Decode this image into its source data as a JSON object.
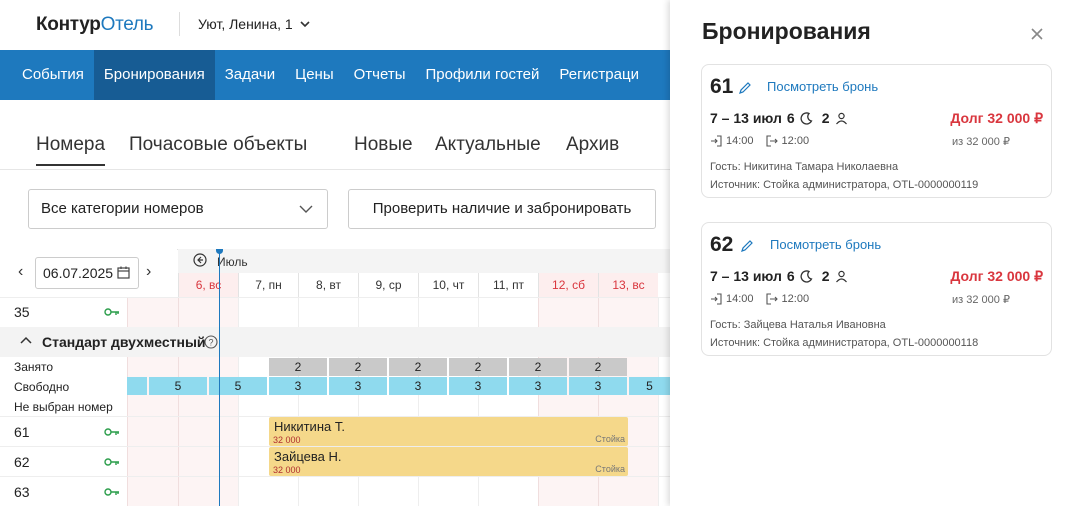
{
  "header": {
    "logo_part1": "Контур",
    "logo_part2": "Отель",
    "hotel_name": "Уют, Ленина, 1"
  },
  "nav": {
    "items": [
      "События",
      "Бронирования",
      "Задачи",
      "Цены",
      "Отчеты",
      "Профили гостей",
      "Регистраци"
    ],
    "active": "Бронирования"
  },
  "tabs": {
    "rooms": "Номера",
    "hourly": "Почасовые объекты",
    "new": "Новые",
    "current": "Актуальные",
    "archive": "Архив"
  },
  "filters": {
    "category_select": "Все категории номеров",
    "check_button": "Проверить наличие и забронировать"
  },
  "calendar": {
    "date": "06.07.2025",
    "month": "Июль",
    "days": [
      {
        "label": "6, вс",
        "weekend": true
      },
      {
        "label": "7, пн",
        "weekend": false
      },
      {
        "label": "8, вт",
        "weekend": false
      },
      {
        "label": "9, ср",
        "weekend": false
      },
      {
        "label": "10, чт",
        "weekend": false
      },
      {
        "label": "11, пт",
        "weekend": false
      },
      {
        "label": "12, сб",
        "weekend": true
      },
      {
        "label": "13, вс",
        "weekend": true
      }
    ],
    "room_above": "35",
    "category": "Стандарт двухместный",
    "occupied_label": "Занято",
    "free_label": "Свободно",
    "unassigned_label": "Не выбран номер",
    "occupied_values": [
      "2",
      "2",
      "2",
      "2",
      "2",
      "2"
    ],
    "free_values": [
      "5",
      "5",
      "3",
      "3",
      "3",
      "3",
      "3",
      "3",
      "5"
    ],
    "rooms": [
      "61",
      "62",
      "63"
    ],
    "bookings": [
      {
        "name": "Никитина Т.",
        "sum": "32 000",
        "source": "Стойка"
      },
      {
        "name": "Зайцева Н.",
        "sum": "32 000",
        "source": "Стойка"
      }
    ]
  },
  "panel": {
    "title": "Бронирования",
    "cards": [
      {
        "room": "61",
        "view": "Посмотреть бронь",
        "dates": "7 – 13 июл",
        "nights": "6",
        "guests": "2",
        "debt": "Долг 32 000 ₽",
        "checkin": "14:00",
        "checkout": "12:00",
        "total": "из 32 000 ₽",
        "guest": "Гость: Никитина Тамара Николаевна",
        "source": "Источник: Стойка администратора, OTL-0000000119"
      },
      {
        "room": "62",
        "view": "Посмотреть бронь",
        "dates": "7 – 13 июл",
        "nights": "6",
        "guests": "2",
        "debt": "Долг 32 000 ₽",
        "checkin": "14:00",
        "checkout": "12:00",
        "total": "из 32 000 ₽",
        "guest": "Гость: Зайцева Наталья Ивановна",
        "source": "Источник: Стойка администратора, OTL-0000000118"
      }
    ]
  },
  "colors": {
    "brand": "#1e79be",
    "nav_active": "#175c94",
    "debt": "#d9363e",
    "booking": "#f5d88a",
    "free": "#8fdaee",
    "occupied": "#c9c9c9"
  }
}
